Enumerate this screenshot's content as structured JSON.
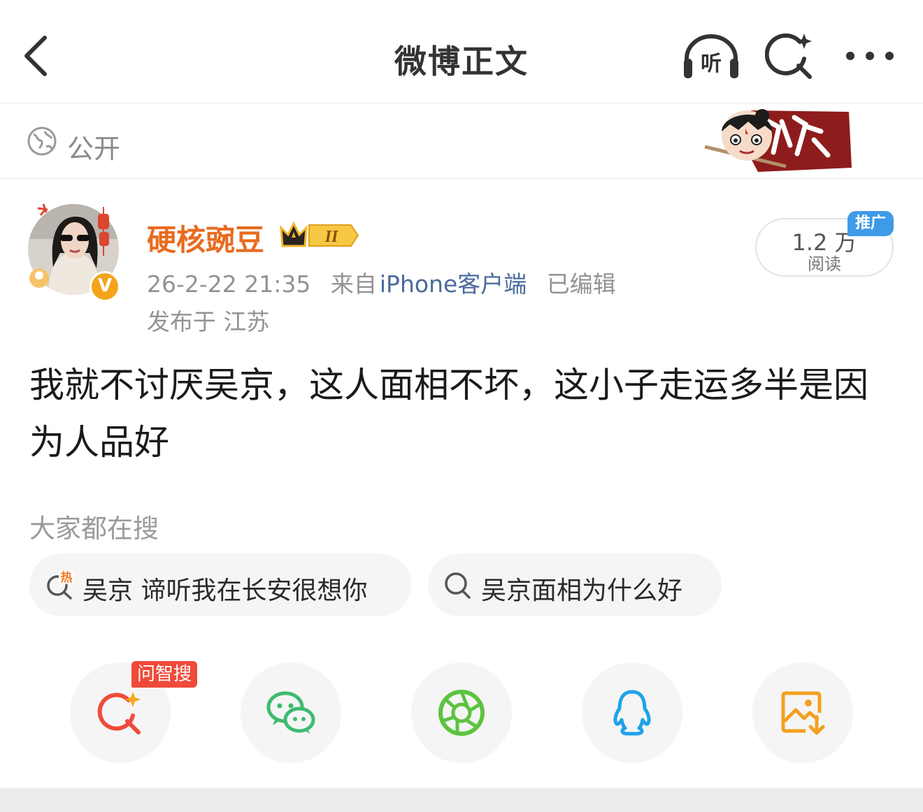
{
  "nav": {
    "title": "微博正文",
    "listen_label": "听"
  },
  "visibility": {
    "label": "公开"
  },
  "post": {
    "username": "硬核豌豆",
    "vip_level": "II",
    "verified_mark": "V",
    "time": "26-2-22 21:35",
    "source_prefix": "来自",
    "source": "iPhone客户端",
    "edited": "已编辑",
    "location": "发布于 江苏",
    "text": "我就不讨厌吴京，这人面相不坏，这小子走运多半是因为人品好"
  },
  "read_stats": {
    "count": "1.2 万",
    "label": "阅读",
    "promo_tag": "推广"
  },
  "hot_search": {
    "title": "大家都在搜",
    "chips": [
      {
        "text": "吴京 谛听我在长安很想你",
        "icon": "hot-search-icon",
        "badge": "热"
      },
      {
        "text": "吴京面相为什么好",
        "icon": "search-icon"
      }
    ]
  },
  "share": {
    "wen_tag": "问智搜",
    "items": [
      {
        "icon": "ai-search-icon",
        "color": "#f04a3a"
      },
      {
        "icon": "wechat-icon",
        "color": "#3dbb6f"
      },
      {
        "icon": "moments-icon",
        "color": "#5cc33f"
      },
      {
        "icon": "qq-icon",
        "color": "#1ea2ea"
      },
      {
        "icon": "save-image-icon",
        "color": "#f2a11e"
      }
    ]
  },
  "colors": {
    "username": "#e86b1f",
    "link": "#4a6a9c",
    "muted": "#939393"
  }
}
